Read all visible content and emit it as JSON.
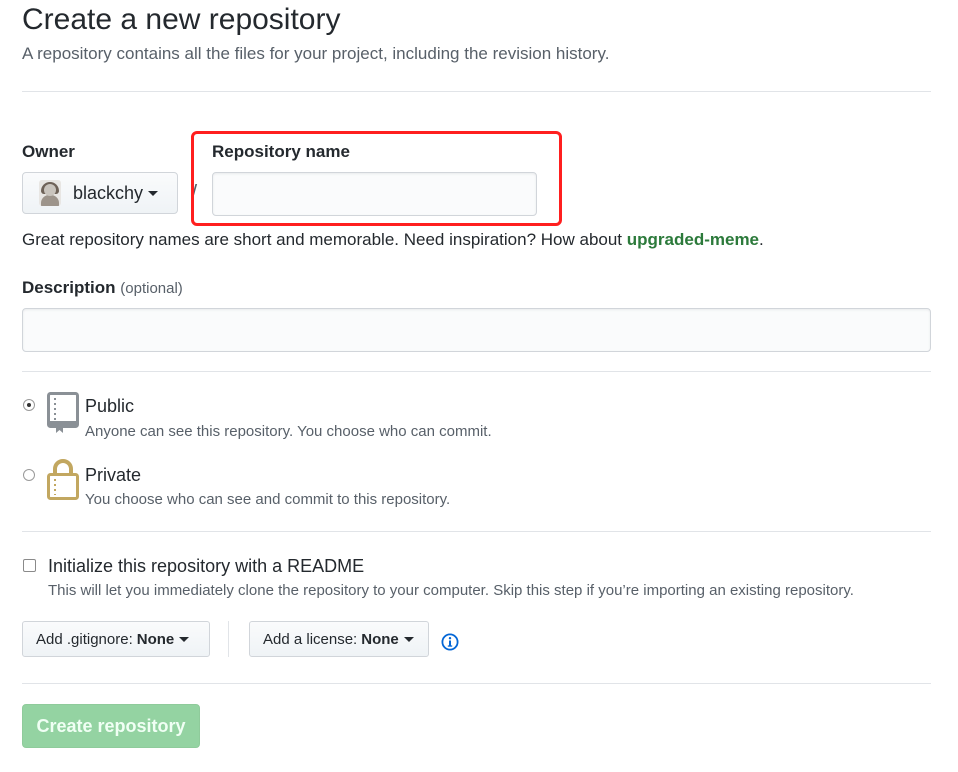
{
  "header": {
    "title": "Create a new repository",
    "subtitle": "A repository contains all the files for your project, including the revision history."
  },
  "owner": {
    "label": "Owner",
    "name": "blackchy",
    "separator": "/"
  },
  "repo_name": {
    "label": "Repository name",
    "value": "",
    "placeholder": ""
  },
  "hint": {
    "text": "Great repository names are short and memorable. Need inspiration? How about ",
    "suggestion": "upgraded-meme",
    "end": "."
  },
  "description": {
    "label": "Description",
    "optional": "(optional)",
    "value": "",
    "placeholder": ""
  },
  "visibility": {
    "selected": "public",
    "public": {
      "title": "Public",
      "desc": "Anyone can see this repository. You choose who can commit.",
      "icon": "repo-book-icon"
    },
    "private": {
      "title": "Private",
      "desc": "You choose who can see and commit to this repository.",
      "icon": "lock-icon"
    }
  },
  "readme": {
    "title": "Initialize this repository with a README",
    "desc": "This will let you immediately clone the repository to your computer. Skip this step if you’re importing an existing repository.",
    "checked": false
  },
  "gitignore": {
    "label": "Add .gitignore:",
    "value": "None"
  },
  "license": {
    "label": "Add a license:",
    "value": "None"
  },
  "submit": {
    "label": "Create repository",
    "enabled": false
  },
  "colors": {
    "highlight": "#ff1f1f",
    "suggestion": "#2c7a3b",
    "submit_bg": "#94d3a2",
    "info": "#0366d6"
  }
}
